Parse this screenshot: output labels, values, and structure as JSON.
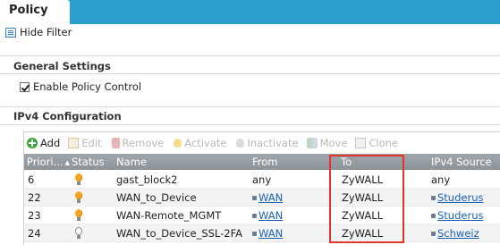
{
  "tabs": {
    "active": "Policy"
  },
  "filter": {
    "hide_label": "Hide Filter"
  },
  "general": {
    "title": "General Settings",
    "enable_label": "Enable Policy Control",
    "enabled": true
  },
  "ipv4": {
    "title": "IPv4 Configuration"
  },
  "toolbar": {
    "add": "Add",
    "edit": "Edit",
    "remove": "Remove",
    "activate": "Activate",
    "inactivate": "Inactivate",
    "move": "Move",
    "clone": "Clone"
  },
  "columns": {
    "priority": "Priori...",
    "status": "Status",
    "name": "Name",
    "from": "From",
    "to": "To",
    "source": "IPv4 Source"
  },
  "rows": [
    {
      "priority": "6",
      "status": "active",
      "name": "gast_block2",
      "from": "any",
      "to": "ZyWALL",
      "source": "any"
    },
    {
      "priority": "22",
      "status": "active",
      "name": "WAN_to_Device",
      "from": "WAN",
      "to": "ZyWALL",
      "source": "Studerus"
    },
    {
      "priority": "23",
      "status": "active",
      "name": "WAN-Remote_MGMT",
      "from": "WAN",
      "to": "ZyWALL",
      "source": "Studerus"
    },
    {
      "priority": "24",
      "status": "inactive",
      "name": "WAN_to_Device_SSL-2FA",
      "from": "WAN",
      "to": "ZyWALL",
      "source": "Schweiz"
    }
  ],
  "colors": {
    "topbar": "#2c9fcf",
    "header": "#939ba1",
    "link": "#1a63b8",
    "highlight": "#e0352b",
    "bulb_on": "#f5a623"
  }
}
